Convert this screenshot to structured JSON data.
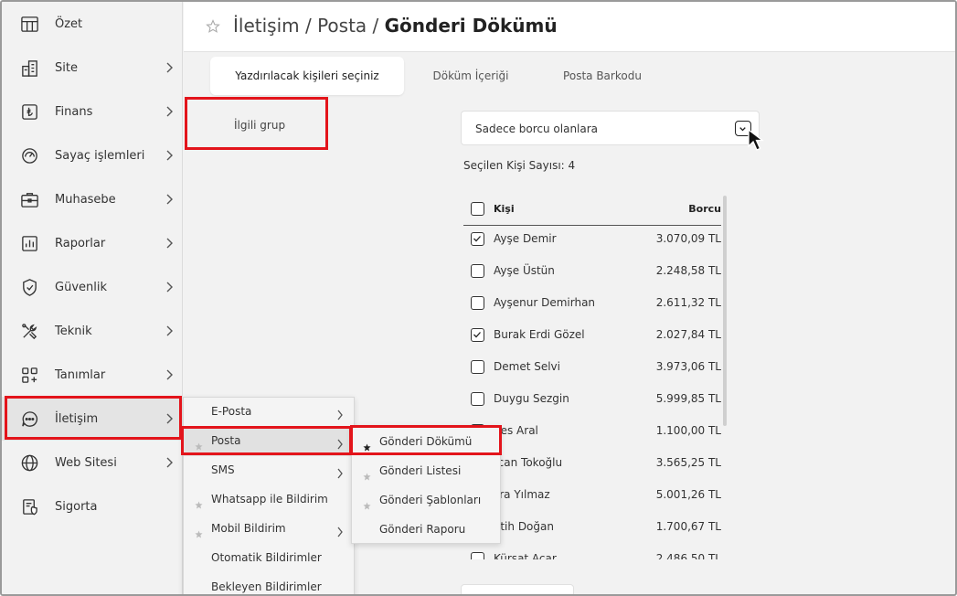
{
  "sidebar": {
    "items": [
      {
        "label": "Özet",
        "icon": "table-icon",
        "has_chevron": false
      },
      {
        "label": "Site",
        "icon": "building-icon",
        "has_chevron": true
      },
      {
        "label": "Finans",
        "icon": "lira-icon",
        "has_chevron": true
      },
      {
        "label": "Sayaç işlemleri",
        "icon": "gauge-icon",
        "has_chevron": true
      },
      {
        "label": "Muhasebe",
        "icon": "briefcase-icon",
        "has_chevron": true
      },
      {
        "label": "Raporlar",
        "icon": "report-chart-icon",
        "has_chevron": true
      },
      {
        "label": "Güvenlik",
        "icon": "shield-icon",
        "has_chevron": true
      },
      {
        "label": "Teknik",
        "icon": "tools-icon",
        "has_chevron": true
      },
      {
        "label": "Tanımlar",
        "icon": "grid-plus-icon",
        "has_chevron": true
      },
      {
        "label": "İletişim",
        "icon": "chat-bubble-icon",
        "has_chevron": true,
        "active": true
      },
      {
        "label": "Web Sitesi",
        "icon": "globe-icon",
        "has_chevron": true
      },
      {
        "label": "Sigorta",
        "icon": "insurance-doc-icon",
        "has_chevron": false
      }
    ]
  },
  "header": {
    "crumb1": "İletişim",
    "sep1": " / ",
    "crumb2": "Posta",
    "sep2": " / ",
    "current": "Gönderi Dökümü"
  },
  "tabs": [
    {
      "label": "Yazdırılacak kişileri seçiniz",
      "active": true
    },
    {
      "label": "Döküm İçeriği",
      "active": false
    },
    {
      "label": "Posta Barkodu",
      "active": false
    }
  ],
  "group": {
    "label": "İlgili grup"
  },
  "filter": {
    "value": "Sadece borcu olanlara"
  },
  "selection": {
    "count_text": "Seçilen Kişi Sayısı: 4"
  },
  "table": {
    "headers": {
      "name": "Kişi",
      "amount": "Borcu"
    },
    "rows": [
      {
        "name": "Ayşe Demir",
        "amount": "3.070,09 TL",
        "checked": true
      },
      {
        "name": "Ayşe Üstün",
        "amount": "2.248,58 TL",
        "checked": false
      },
      {
        "name": "Ayşenur Demirhan",
        "amount": "2.611,32 TL",
        "checked": false
      },
      {
        "name": "Burak Erdi Gözel",
        "amount": "2.027,84 TL",
        "checked": true
      },
      {
        "name": "Demet Selvi",
        "amount": "3.973,06 TL",
        "checked": false
      },
      {
        "name": "Duygu Sezgin",
        "amount": "5.999,85 TL",
        "checked": false
      },
      {
        "name": "nes Aral",
        "amount": "1.100,00 TL",
        "checked": false
      },
      {
        "name": "rcan Tokoğlu",
        "amount": "3.565,25 TL",
        "checked": false
      },
      {
        "name": "sra Yılmaz",
        "amount": "5.001,26 TL",
        "checked": false
      },
      {
        "name": "atih Doğan",
        "amount": "1.700,67 TL",
        "checked": false
      },
      {
        "name": "Kürşat Acar",
        "amount": "2.486,50 TL",
        "checked": false
      }
    ]
  },
  "menu1": {
    "items": [
      {
        "label": "E-Posta",
        "star": false,
        "chevron": true
      },
      {
        "label": "Posta",
        "star": true,
        "chevron": true,
        "active": true
      },
      {
        "label": "SMS",
        "star": false,
        "chevron": true
      },
      {
        "label": "Whatsapp ile Bildirim",
        "star": true,
        "chevron": false
      },
      {
        "label": "Mobil Bildirim",
        "star": true,
        "chevron": true
      },
      {
        "label": "Otomatik Bildirimler",
        "star": false,
        "chevron": false
      },
      {
        "label": "Bekleyen Bildirimler",
        "star": false,
        "chevron": false
      }
    ]
  },
  "menu2": {
    "items": [
      {
        "label": "Gönderi Dökümü",
        "star": true,
        "star_filled": true
      },
      {
        "label": "Gönderi Listesi",
        "star": true,
        "star_filled": false
      },
      {
        "label": "Gönderi Şablonları",
        "star": true,
        "star_filled": false
      },
      {
        "label": "Gönderi Raporu",
        "star": false,
        "star_filled": false
      }
    ]
  },
  "colors": {
    "highlight": "#e3141b",
    "accent_dark": "#222222"
  }
}
